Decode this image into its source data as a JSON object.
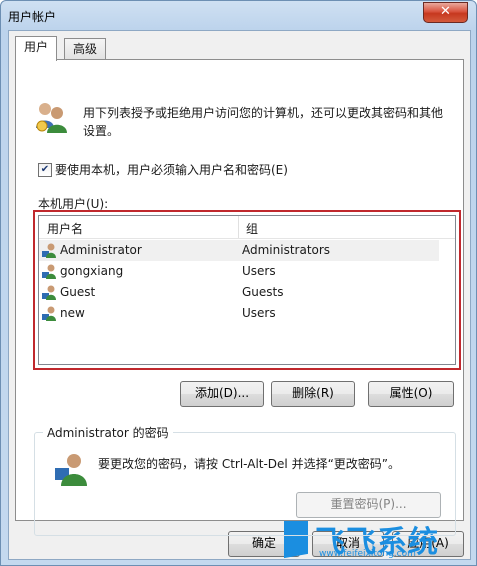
{
  "window": {
    "title": "用户帐户",
    "close_glyph": "✕"
  },
  "tabs": [
    {
      "label": "用户"
    },
    {
      "label": "高级"
    }
  ],
  "users_tab": {
    "description": "用下列表授予或拒绝用户访问您的计算机，还可以更改其密码和其他设置。",
    "require_login": {
      "label": "要使用本机，用户必须输入用户名和密码(E)",
      "checked": true,
      "check_glyph": "✔"
    },
    "local_users_label": "本机用户(U):",
    "columns": {
      "name": "用户名",
      "group": "组"
    },
    "users": [
      {
        "name": "Administrator",
        "group": "Administrators",
        "selected": true
      },
      {
        "name": "gongxiang",
        "group": "Users"
      },
      {
        "name": "Guest",
        "group": "Guests"
      },
      {
        "name": "new",
        "group": "Users"
      }
    ],
    "buttons": {
      "add": "添加(D)...",
      "remove": "删除(R)",
      "properties": "属性(O)"
    },
    "password_group": {
      "title": "Administrator 的密码",
      "text": "要更改您的密码，请按 Ctrl-Alt-Del 并选择“更改密码”。",
      "reset_button": "重置密码(P)..."
    }
  },
  "footer": {
    "ok": "确定",
    "cancel": "取消",
    "apply": "应用(A)"
  },
  "watermark": {
    "brand": "飞飞系统",
    "url": "www.feifeixitong.com"
  },
  "colors": {
    "highlight_frame": "#c0282d",
    "watermark": "#1b8ee0",
    "close_button": "#c6381f"
  }
}
